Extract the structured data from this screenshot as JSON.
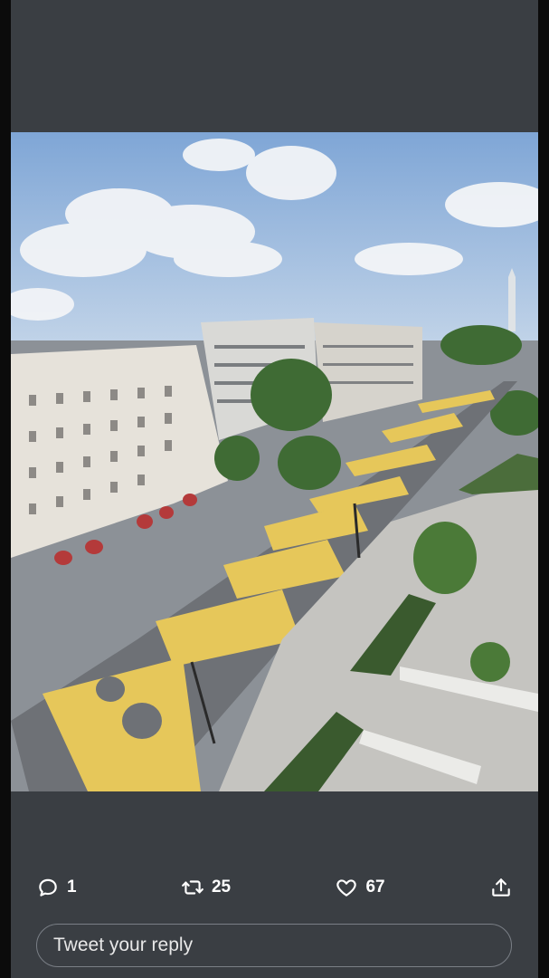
{
  "tweet": {
    "media_alt": "Aerial view of a street with large yellow painted letters",
    "actions": {
      "reply": {
        "icon": "reply-icon",
        "count": "1"
      },
      "retweet": {
        "icon": "retweet-icon",
        "count": "25"
      },
      "like": {
        "icon": "heart-icon",
        "count": "67"
      },
      "share": {
        "icon": "share-icon"
      }
    },
    "reply_box": {
      "placeholder": "Tweet your reply"
    }
  },
  "colors": {
    "background": "#3a3e43",
    "frame": "#0b0b0b",
    "text": "#ffffff",
    "reply_border": "#7a7f86"
  }
}
